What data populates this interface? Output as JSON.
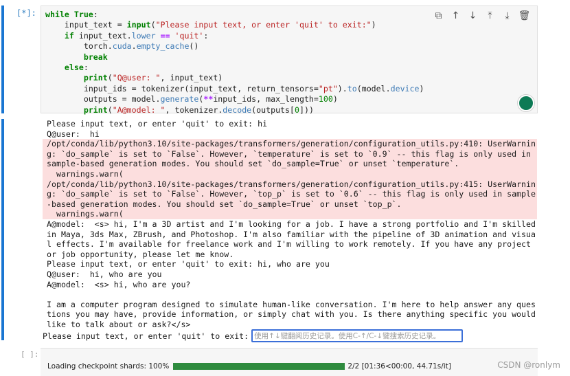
{
  "cell": {
    "prompt": "[*]:",
    "code_lines": [
      "while True:",
      "    input_text = input(\"Please input text, or enter 'quit' to exit:\")",
      "    if input_text.lower == 'quit':",
      "        torch.cuda.empty_cache()",
      "        break",
      "    else:",
      "        print(\"Q@user: \", input_text)",
      "        input_ids = tokenizer(input_text, return_tensors=\"pt\").to(model.device)",
      "        outputs = model.generate(**input_ids, max_length=100)",
      "        print(\"A@model: \", tokenizer.decode(outputs[0]))"
    ],
    "toolbar": [
      {
        "name": "copy-cell-icon",
        "glyph": "⧉"
      },
      {
        "name": "move-up-icon",
        "glyph": "↑"
      },
      {
        "name": "move-down-icon",
        "glyph": "↓"
      },
      {
        "name": "insert-above-icon",
        "glyph": "⤒"
      },
      {
        "name": "insert-below-icon",
        "glyph": "⤓"
      },
      {
        "name": "delete-cell-icon",
        "glyph": "🗑"
      }
    ]
  },
  "output": {
    "lines": [
      {
        "text": "Please input text, or enter 'quit' to exit: hi",
        "stderr": false
      },
      {
        "text": "Q@user:  hi",
        "stderr": false
      },
      {
        "text": "/opt/conda/lib/python3.10/site-packages/transformers/generation/configuration_utils.py:410: UserWarning: `do_sample` is set to `False`. However, `temperature` is set to `0.9` -- this flag is only used in sample-based generation modes. You should set `do_sample=True` or unset `temperature`.\n  warnings.warn(",
        "stderr": true
      },
      {
        "text": "/opt/conda/lib/python3.10/site-packages/transformers/generation/configuration_utils.py:415: UserWarning: `do_sample` is set to `False`. However, `top_p` is set to `0.6` -- this flag is only used in sample-based generation modes. You should set `do_sample=True` or unset `top_p`.\n  warnings.warn(",
        "stderr": true
      },
      {
        "text": "A@model:  <s> hi, I'm a 3D artist and I'm looking for a job. I have a strong portfolio and I'm skilled in Maya, 3ds Max, ZBrush, and Photoshop. I'm also familiar with the pipeline of 3D animation and visual effects. I'm available for freelance work and I'm willing to work remotely. If you have any project or job opportunity, please let me know.",
        "stderr": false
      },
      {
        "text": "Please input text, or enter 'quit' to exit: hi, who are you",
        "stderr": false
      },
      {
        "text": "Q@user:  hi, who are you",
        "stderr": false
      },
      {
        "text": "A@model:  <s> hi, who are you?",
        "stderr": false
      },
      {
        "text": "",
        "stderr": false
      },
      {
        "text": "I am a computer program designed to simulate human-like conversation. I'm here to help answer any questions you may have, provide information, or simply chat with you. Is there anything specific you would like to talk about or ask?</s>",
        "stderr": false
      }
    ],
    "stdin_prompt": "Please input text, or enter 'quit' to exit:",
    "stdin_placeholder": "使用↑↓键翻阅历史记录。使用C-↑/C-↓键搜索历史记录。"
  },
  "next_cell": {
    "prompt": "[ ]:",
    "progress_label": "Loading checkpoint shards: 100%",
    "progress_fraction": 1.0,
    "progress_stats": "2/2 [01:36<00:00, 44.71s/it]"
  },
  "watermark": "CSDN @ronlym",
  "colors": {
    "accent": "#1976d2",
    "stderr_bg": "#fcdede",
    "progress": "#2e8b3e"
  }
}
